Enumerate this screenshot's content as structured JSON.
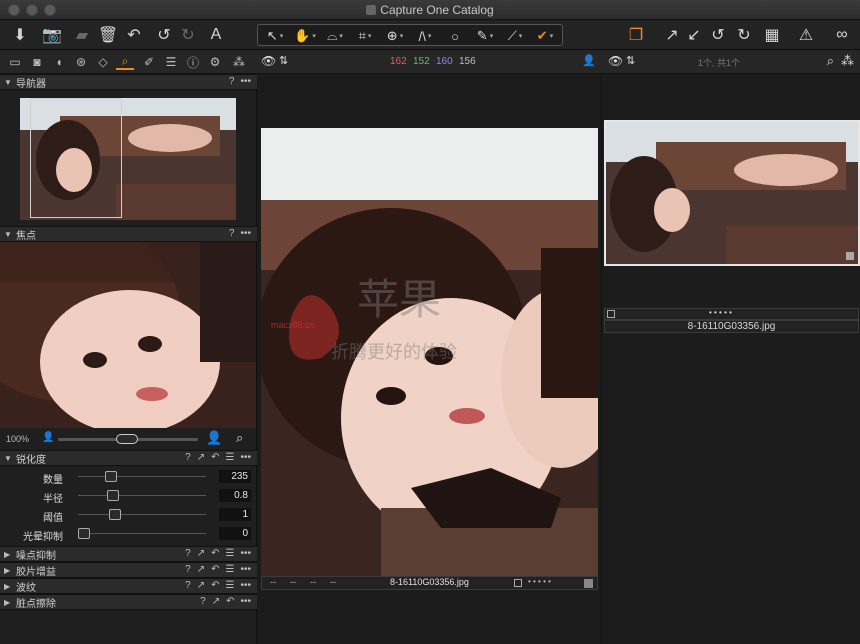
{
  "window": {
    "title": "Capture One Catalog"
  },
  "toolbar": {
    "left_icons": [
      "import-icon",
      "camera-icon",
      "folder-icon",
      "trash-icon",
      "undo-icon",
      "redo-left-icon",
      "redo-right-icon",
      "text-icon"
    ],
    "tools": [
      "pointer-icon",
      "pan-icon",
      "crop-shape-icon",
      "crop-icon",
      "rotate-icon",
      "straighten-icon",
      "circle-icon",
      "brush-icon",
      "picker-icon",
      "annotation-icon"
    ],
    "right_icons": [
      "stack-icon",
      "arrow-ne-icon",
      "arrow-sw-icon",
      "rotate-left-icon",
      "rotate-right-icon",
      "grid-icon",
      "warning-icon",
      "glasses-icon"
    ],
    "accent_color": "#f08a24"
  },
  "left_panel": {
    "tabs": [
      "folder-icon",
      "camera-icon",
      "exposure-icon",
      "color-icon",
      "lens-icon",
      "focus-icon",
      "brush-icon",
      "list-icon",
      "info-icon",
      "settings-icon",
      "batch-icon"
    ],
    "navigator": {
      "title": "导航器"
    },
    "focus": {
      "title": "焦点"
    },
    "zoom": {
      "percent": "100%"
    },
    "sharpening": {
      "title": "锐化度",
      "params": [
        {
          "label": "数量",
          "value": "235",
          "pos": 0.23
        },
        {
          "label": "半径",
          "value": "0.8",
          "pos": 0.25
        },
        {
          "label": "阈值",
          "value": "1",
          "pos": 0.27
        },
        {
          "label": "光晕抑制",
          "value": "0",
          "pos": 0.0
        }
      ]
    },
    "sections": [
      "噪点抑制",
      "胶片增益",
      "波纹",
      "脏点擦除"
    ]
  },
  "viewer": {
    "channels": [
      "162",
      "152",
      "160",
      "156"
    ],
    "channel_colors": [
      "#e0605f",
      "#5fc05f",
      "#7a7ae8",
      "#bdbdbd"
    ],
    "filename": "8-16110G03356.jpg",
    "meta_dashes": [
      "--",
      "--",
      "--",
      "--"
    ],
    "watermark_cn": "苹果",
    "watermark_sub": "macx86.cn",
    "watermark_tag": "折腾更好的体验"
  },
  "browser": {
    "count_text": "1个, 共1个",
    "filename": "8-16110G03356.jpg",
    "rating_dots": "• • • • •"
  }
}
